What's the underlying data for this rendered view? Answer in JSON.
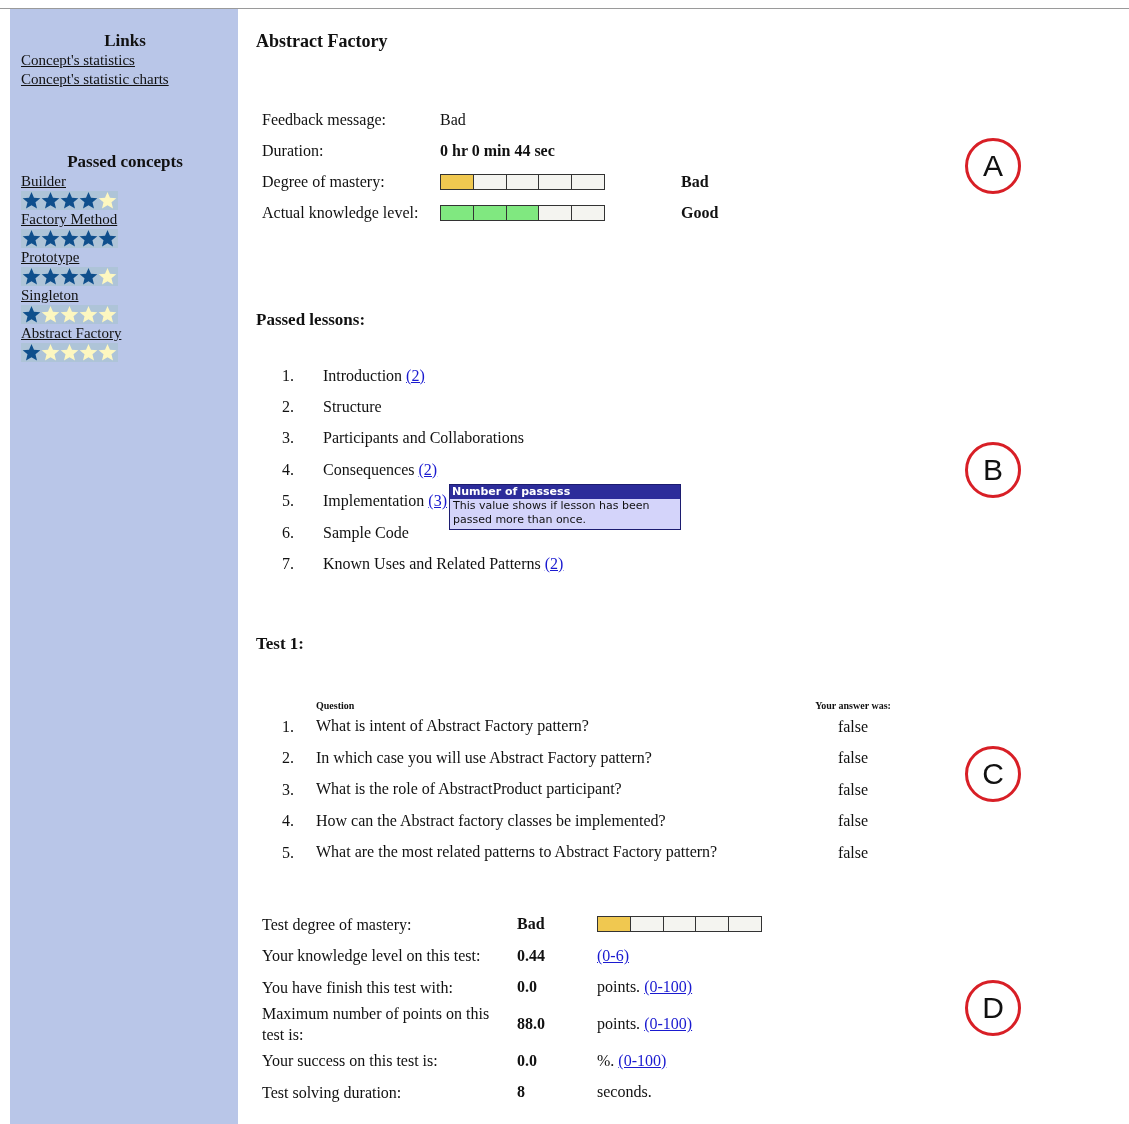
{
  "sidebar": {
    "links_heading": "Links",
    "links": [
      "Concept's statistics",
      "Concept's statistic charts"
    ],
    "concepts_heading": "Passed concepts",
    "concepts": [
      {
        "name": "Builder",
        "stars": 4
      },
      {
        "name": "Factory Method",
        "stars": 5
      },
      {
        "name": "Prototype",
        "stars": 4
      },
      {
        "name": "Singleton",
        "stars": 1
      },
      {
        "name": "Abstract Factory",
        "stars": 1
      }
    ]
  },
  "title": "Abstract Factory",
  "summary": {
    "marker": "A",
    "rows": [
      {
        "kind": "text",
        "label": "Feedback message:",
        "value": "Bad",
        "bold": false
      },
      {
        "kind": "text",
        "label": "Duration:",
        "value": "0 hr 0 min 44 sec",
        "bold": true
      },
      {
        "kind": "meter",
        "label": "Degree of mastery:",
        "level": 0.2,
        "color": "#f0c850",
        "rating": "Bad"
      },
      {
        "kind": "meter",
        "label": "Actual knowledge level:",
        "level": 0.6,
        "color": "#80e880",
        "rating": "Good"
      }
    ]
  },
  "lessons": {
    "heading": "Passed lessons:",
    "marker": "B",
    "items": [
      {
        "number": "1.",
        "title": "Introduction",
        "passes": "(2)"
      },
      {
        "number": "2.",
        "title": "Structure"
      },
      {
        "number": "3.",
        "title": "Participants and Collaborations"
      },
      {
        "number": "4.",
        "title": "Consequences",
        "passes": "(2)"
      },
      {
        "number": "5.",
        "title": "Implementation",
        "passes": "(3)",
        "tooltip": {
          "title": "Number of passess",
          "text": "This value shows if lesson has been passed more than once."
        }
      },
      {
        "number": "6.",
        "title": "Sample Code"
      },
      {
        "number": "7.",
        "title": "Known Uses and Related Patterns",
        "passes": "(2)"
      }
    ]
  },
  "test": {
    "heading": "Test 1:",
    "marker": "C",
    "question_header": "Question",
    "answer_header": "Your answer was:",
    "questions": [
      {
        "number": "1.",
        "text": "What is intent of Abstract Factory pattern?",
        "answer": "false"
      },
      {
        "number": "2.",
        "text": "In which case you will use Abstract Factory pattern?",
        "answer": "false"
      },
      {
        "number": "3.",
        "text": "What is the role of AbstractProduct participant?",
        "answer": "false"
      },
      {
        "number": "4.",
        "text": "How can the Abstract factory classes be implemented?",
        "answer": "false"
      },
      {
        "number": "5.",
        "text": "What are the most related patterns to Abstract Factory pattern?",
        "answer": "false"
      }
    ]
  },
  "results": {
    "marker": "D",
    "rows": [
      {
        "kind": "meter",
        "label": "Test degree of mastery:",
        "value": "Bad",
        "level": 0.2,
        "color": "#f0c850"
      },
      {
        "kind": "range",
        "label": "Your knowledge level on this test:",
        "value": "0.44",
        "range": "(0-6)"
      },
      {
        "kind": "range",
        "label": "You have finish this test with:",
        "value": "0.0",
        "unit": "points.",
        "range": "(0-100)"
      },
      {
        "kind": "range",
        "label": "Maximum number of points on this test is:",
        "value": "88.0",
        "unit": "points.",
        "range": "(0-100)"
      },
      {
        "kind": "range",
        "label": "Your success on this test is:",
        "value": "0.0",
        "unit": "%.",
        "range": "(0-100)"
      },
      {
        "kind": "range",
        "label": "Test solving duration:",
        "value": "8",
        "unit": "seconds."
      }
    ]
  }
}
